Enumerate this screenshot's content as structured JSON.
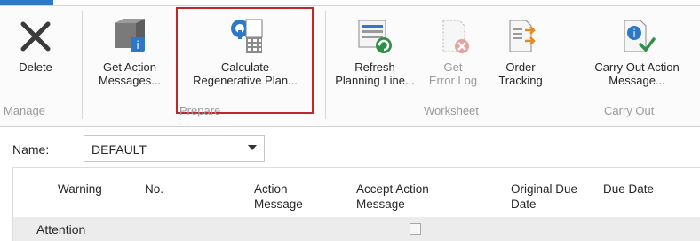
{
  "ribbon": {
    "buttons": {
      "delete": "Delete",
      "get_action_messages": [
        "Get Action",
        "Messages..."
      ],
      "calculate_regenerative_plan": [
        "Calculate",
        "Regenerative Plan..."
      ],
      "refresh_planning_line": [
        "Refresh",
        "Planning Line..."
      ],
      "get_error_log": [
        "Get",
        "Error Log"
      ],
      "order_tracking": [
        "Order",
        "Tracking"
      ],
      "carry_out_action_message": [
        "Carry Out Action",
        "Message..."
      ]
    },
    "groups": {
      "manage": "Manage",
      "prepare": "Prepare",
      "worksheet": "Worksheet",
      "carry_out": "Carry Out"
    }
  },
  "name_field": {
    "label": "Name:",
    "value": "DEFAULT"
  },
  "grid": {
    "columns": {
      "warning": "Warning",
      "no": "No.",
      "action_message": [
        "Action",
        "Message"
      ],
      "accept_action_message": [
        "Accept Action",
        "Message"
      ],
      "original_due_date": [
        "Original Due",
        "Date"
      ],
      "due_date": "Due Date"
    },
    "rows": [
      {
        "warning": "Attention",
        "accept_action_message": false
      }
    ]
  },
  "colors": {
    "highlight_border": "#c0272d",
    "icon_blue": "#2d79c7",
    "icon_green": "#2f8f46",
    "icon_red": "#d9534f",
    "group_label": "#9a9a9a"
  }
}
